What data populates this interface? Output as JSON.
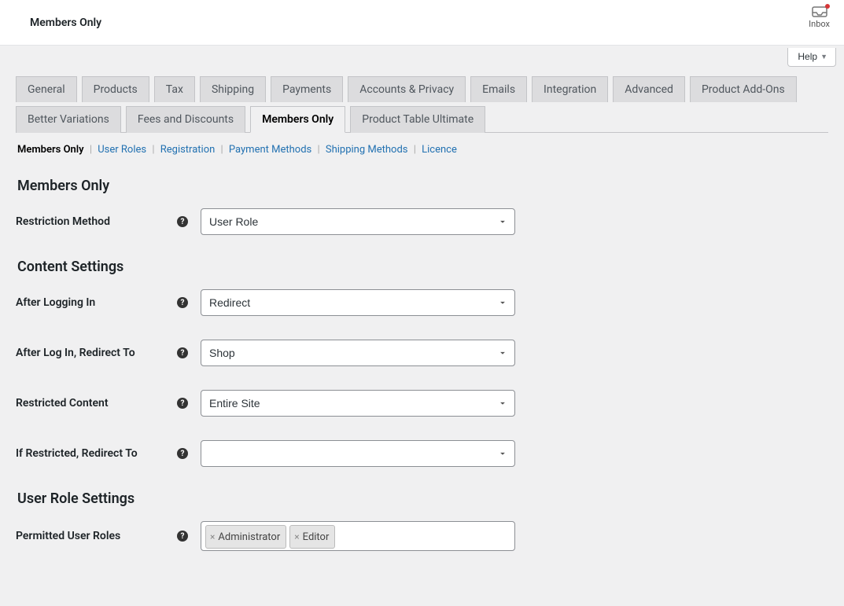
{
  "header": {
    "title": "Members Only",
    "inbox_label": "Inbox",
    "help_label": "Help"
  },
  "tabs": [
    {
      "label": "General",
      "active": false
    },
    {
      "label": "Products",
      "active": false
    },
    {
      "label": "Tax",
      "active": false
    },
    {
      "label": "Shipping",
      "active": false
    },
    {
      "label": "Payments",
      "active": false
    },
    {
      "label": "Accounts & Privacy",
      "active": false
    },
    {
      "label": "Emails",
      "active": false
    },
    {
      "label": "Integration",
      "active": false
    },
    {
      "label": "Advanced",
      "active": false
    },
    {
      "label": "Product Add-Ons",
      "active": false
    },
    {
      "label": "Better Variations",
      "active": false
    },
    {
      "label": "Fees and Discounts",
      "active": false
    },
    {
      "label": "Members Only",
      "active": true
    },
    {
      "label": "Product Table Ultimate",
      "active": false
    }
  ],
  "subsections": [
    {
      "label": "Members Only",
      "current": true
    },
    {
      "label": "User Roles",
      "current": false
    },
    {
      "label": "Registration",
      "current": false
    },
    {
      "label": "Payment Methods",
      "current": false
    },
    {
      "label": "Shipping Methods",
      "current": false
    },
    {
      "label": "Licence",
      "current": false
    }
  ],
  "sections": {
    "s1": {
      "title": "Members Only"
    },
    "s2": {
      "title": "Content Settings"
    },
    "s3": {
      "title": "User Role Settings"
    }
  },
  "fields": {
    "restriction_method": {
      "label": "Restriction Method",
      "value": "User Role"
    },
    "after_logging_in": {
      "label": "After Logging In",
      "value": "Redirect"
    },
    "after_login_redirect": {
      "label": "After Log In, Redirect To",
      "value": "Shop"
    },
    "restricted_content": {
      "label": "Restricted Content",
      "value": "Entire Site"
    },
    "if_restricted_redirect": {
      "label": "If Restricted, Redirect To",
      "value": ""
    },
    "permitted_roles": {
      "label": "Permitted User Roles",
      "values": [
        "Administrator",
        "Editor"
      ]
    }
  }
}
